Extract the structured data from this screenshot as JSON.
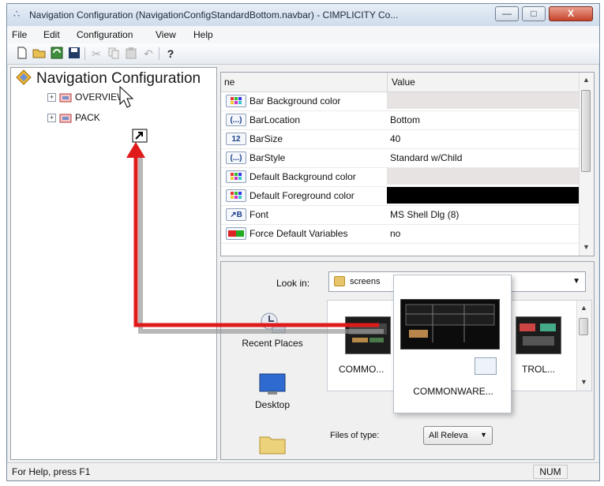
{
  "window": {
    "title": "Navigation Configuration (NavigationConfigStandardBottom.navbar) - CIMPLICITY Co...",
    "minimize_glyph": "—",
    "maximize_glyph": "□",
    "close_glyph": "X"
  },
  "menu": [
    "File",
    "Edit",
    "Configuration",
    "View",
    "Help"
  ],
  "toolbar": {
    "icons": [
      "new-icon",
      "open-icon",
      "refresh-icon",
      "save-icon",
      "cut-icon",
      "copy-icon",
      "paste-icon",
      "undo-icon",
      "help-icon"
    ],
    "help_glyph": "?"
  },
  "tree": {
    "root": "Navigation Configuration",
    "nodes": [
      {
        "label": "OVERVIEW",
        "expander": "+"
      },
      {
        "label": "PACK",
        "expander": "+"
      }
    ]
  },
  "properties": {
    "name_header": "ne",
    "value_header": "Value",
    "rows": [
      {
        "icon_text": "",
        "icon": "color-grid-icon",
        "name": "Bar Background color",
        "value": "",
        "swatch": "#e7e3e3"
      },
      {
        "icon_text": "(...)",
        "icon": "enum-icon",
        "name": "BarLocation",
        "value": "Bottom",
        "swatch": ""
      },
      {
        "icon_text": "12",
        "icon": "number-icon",
        "name": "BarSize",
        "value": "40",
        "swatch": ""
      },
      {
        "icon_text": "(...)",
        "icon": "enum-icon",
        "name": "BarStyle",
        "value": "Standard w/Child",
        "swatch": ""
      },
      {
        "icon_text": "",
        "icon": "color-grid-icon",
        "name": "Default Background color",
        "value": "",
        "swatch": "#e7e3e3"
      },
      {
        "icon_text": "",
        "icon": "color-grid-icon",
        "name": "Default Foreground color",
        "value": "",
        "swatch": "#000000"
      },
      {
        "icon_text": "↗B",
        "icon": "font-icon",
        "name": "Font",
        "value": "MS Shell Dlg (8)",
        "swatch": ""
      },
      {
        "icon_text": "",
        "icon": "toggle-icon",
        "name": "Force Default Variables",
        "value": "no",
        "swatch": ""
      }
    ],
    "scroll_up": "▲",
    "scroll_down": "▼"
  },
  "file_dialog": {
    "look_in_label": "Look in:",
    "look_in_value": "screens",
    "places": [
      "Recent Places",
      "Desktop"
    ],
    "files": [
      {
        "label": "COMMO..."
      },
      {
        "label": "COMMONWARE..."
      },
      {
        "label": "TROL..."
      }
    ],
    "files_of_type_label": "Files of type:",
    "files_of_type_value": "All Releva",
    "dropdown_glyph": "▼"
  },
  "statusbar": {
    "help_text": "For Help, press F1",
    "num": "NUM"
  },
  "colors": {
    "drag_arrow": "#e01a1a",
    "drag_shadow": "#9a9a9a"
  }
}
